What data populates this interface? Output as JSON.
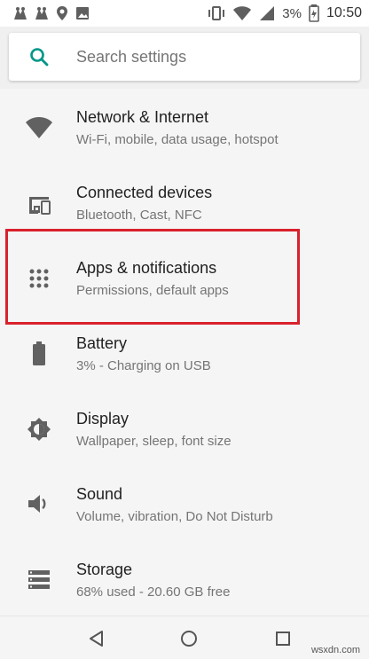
{
  "status_bar": {
    "battery_percent": "3%",
    "time": "10:50",
    "icons": [
      "notification-icon",
      "notification-icon",
      "location-pin-icon",
      "image-icon",
      "vibrate-icon",
      "wifi-icon",
      "signal-icon",
      "battery-icon"
    ]
  },
  "search": {
    "placeholder": "Search settings",
    "icon": "search-icon",
    "accent_color": "#009688"
  },
  "settings": {
    "items": [
      {
        "icon": "wifi-icon",
        "title": "Network & Internet",
        "subtitle": "Wi-Fi, mobile, data usage, hotspot"
      },
      {
        "icon": "devices-icon",
        "title": "Connected devices",
        "subtitle": "Bluetooth, Cast, NFC"
      },
      {
        "icon": "apps-grid-icon",
        "title": "Apps & notifications",
        "subtitle": "Permissions, default apps"
      },
      {
        "icon": "battery-icon",
        "title": "Battery",
        "subtitle": "3% - Charging on USB"
      },
      {
        "icon": "brightness-icon",
        "title": "Display",
        "subtitle": "Wallpaper, sleep, font size"
      },
      {
        "icon": "volume-icon",
        "title": "Sound",
        "subtitle": "Volume, vibration, Do Not Disturb"
      },
      {
        "icon": "storage-icon",
        "title": "Storage",
        "subtitle": "68% used - 20.60 GB free"
      }
    ]
  },
  "highlight_color": "#d9212c",
  "nav_bar": {
    "buttons": [
      "back-icon",
      "home-icon",
      "recents-icon"
    ]
  },
  "watermark": "wsxdn.com"
}
